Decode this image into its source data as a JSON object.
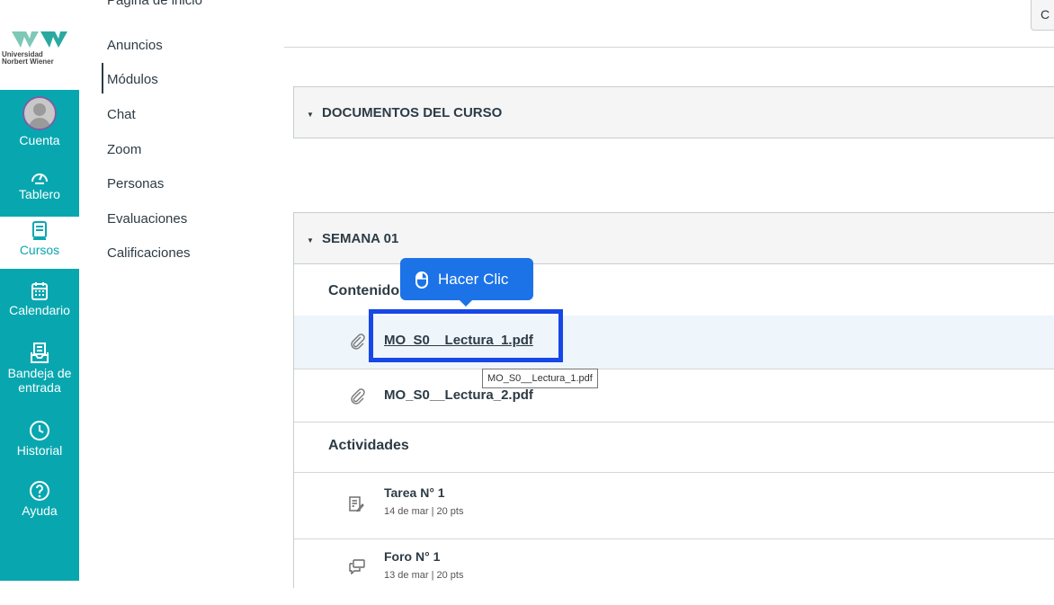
{
  "global_nav": {
    "logo_text": "Universidad\nNorbert Wiener",
    "items": [
      {
        "label": "Cuenta",
        "icon": "account-avatar-icon"
      },
      {
        "label": "Tablero",
        "icon": "dashboard-icon"
      },
      {
        "label": "Cursos",
        "icon": "courses-icon"
      },
      {
        "label": "Calendario",
        "icon": "calendar-icon"
      },
      {
        "label": "Bandeja de\nentrada",
        "icon": "inbox-icon"
      },
      {
        "label": "Historial",
        "icon": "history-icon"
      },
      {
        "label": "Ayuda",
        "icon": "help-icon"
      }
    ],
    "colors": {
      "nav_bg": "#08a7b0",
      "active_text": "#08a7b0"
    }
  },
  "course_nav": {
    "items": [
      "Página de inicio",
      "Anuncios",
      "Módulos",
      "Chat",
      "Zoom",
      "Personas",
      "Evaluaciones",
      "Calificaciones"
    ],
    "active": "Módulos"
  },
  "top_button": {
    "label": "C"
  },
  "modules": [
    {
      "title": "DOCUMENTOS DEL CURSO"
    },
    {
      "title": "SEMANA 01",
      "contenido_header": "Contenido",
      "files": [
        "MO_S0__Lectura_1.pdf",
        "MO_S0__Lectura_2.pdf"
      ],
      "actividades_header": "Actividades",
      "activities": [
        {
          "title": "Tarea N° 1",
          "meta": "14 de mar  |  20 pts",
          "icon": "assignment-icon"
        },
        {
          "title": "Foro N° 1",
          "meta": "13 de mar  |  20 pts",
          "icon": "discussion-icon"
        }
      ]
    }
  ],
  "overlay": {
    "callout_text": "Hacer Clic",
    "callout_icon": "mouse-icon",
    "hover_tooltip": "MO_S0__Lectura_1.pdf",
    "accent": "#1c73e8",
    "box_color": "#1747e6"
  }
}
